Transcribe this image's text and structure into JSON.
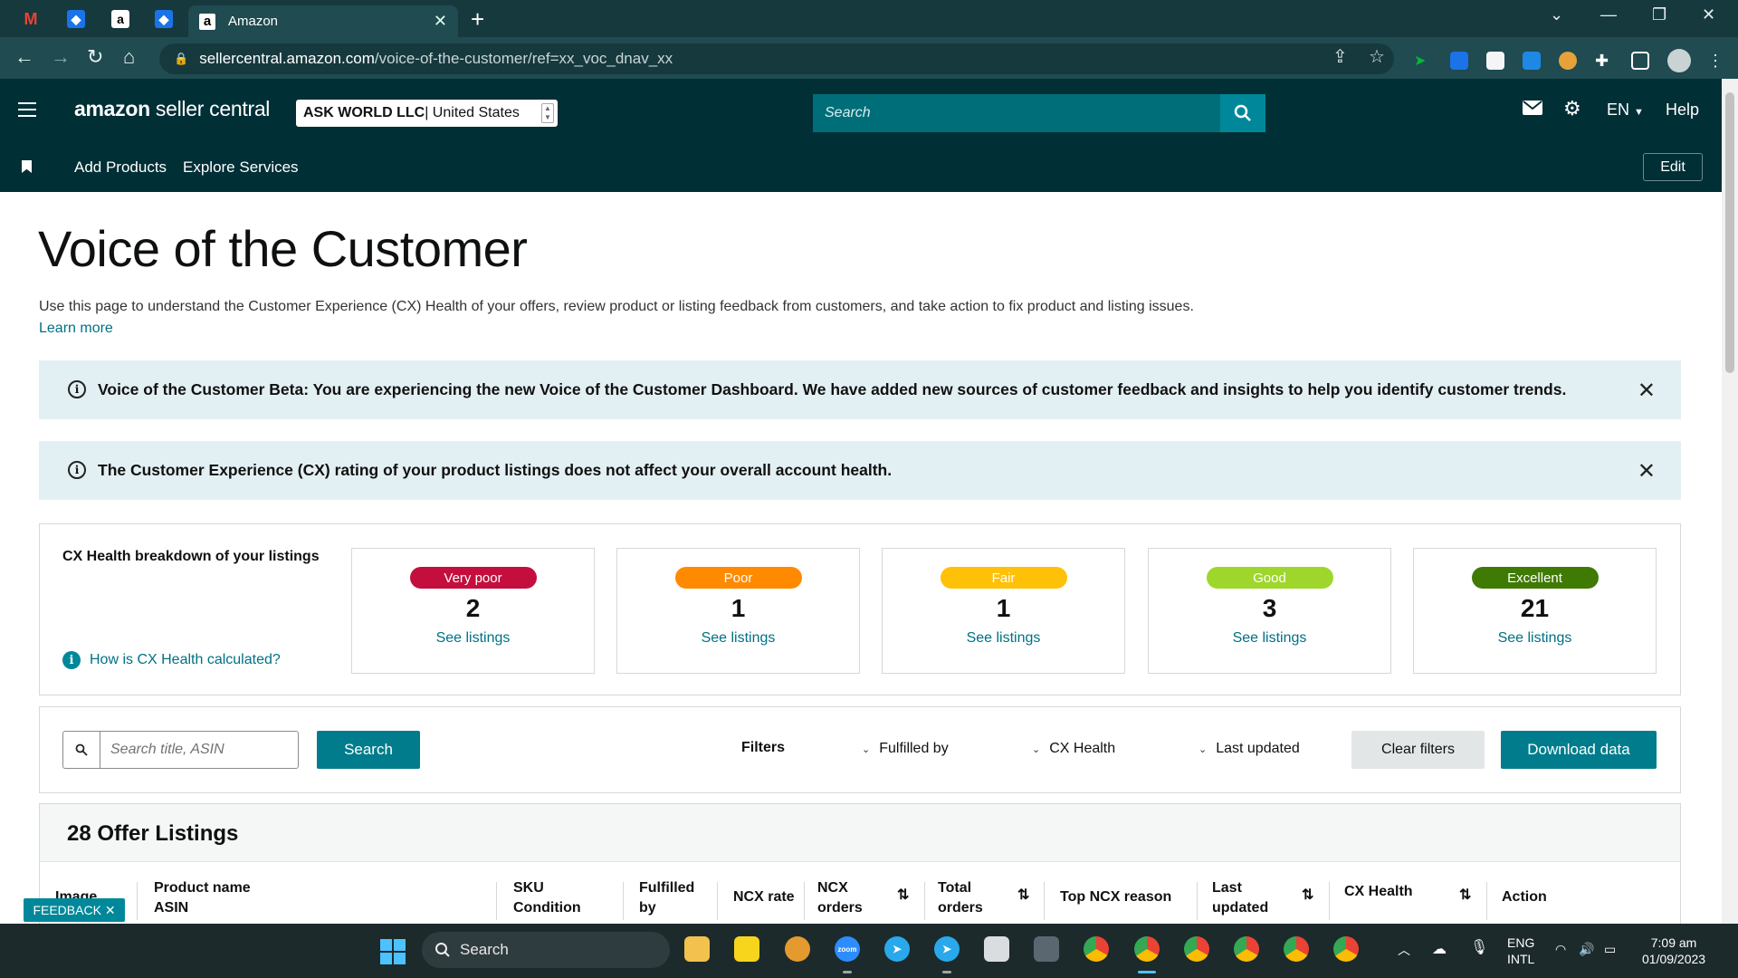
{
  "browser": {
    "tab_title": "Amazon",
    "url_host": "sellercentral.amazon.com",
    "url_path": "/voice-of-the-customer/ref=xx_voc_dnav_xx"
  },
  "header": {
    "logo_brand": "amazon",
    "logo_suffix": " seller central",
    "account_name": "ASK WORLD LLC",
    "account_region": " | United States",
    "search_placeholder": "Search",
    "language": "EN",
    "help": "Help"
  },
  "subnav": {
    "items": [
      "Add Products",
      "Explore Services"
    ],
    "edit": "Edit"
  },
  "page": {
    "title": "Voice of the Customer",
    "description": "Use this page to understand the Customer Experience (CX) Health of your offers, review product or listing feedback from customers, and take action to fix product and listing issues.",
    "learn_more": "Learn more"
  },
  "alerts": [
    "Voice of the Customer Beta: You are experiencing the new Voice of the Customer Dashboard. We have added new sources of customer feedback and insights to help you identify customer trends.",
    "The Customer Experience (CX) rating of your product listings does not affect your overall account health."
  ],
  "cx_health": {
    "title": "CX Health breakdown of your listings",
    "help_link": "How is CX Health calculated?",
    "see_listings": "See listings",
    "categories": [
      {
        "label": "Very poor",
        "count": "2",
        "color": "#c40f3e"
      },
      {
        "label": "Poor",
        "count": "1",
        "color": "#ff8a00"
      },
      {
        "label": "Fair",
        "count": "1",
        "color": "#ffc107"
      },
      {
        "label": "Good",
        "count": "3",
        "color": "#9fd62c"
      },
      {
        "label": "Excellent",
        "count": "21",
        "color": "#3f7a05"
      }
    ]
  },
  "filters": {
    "search_placeholder": "Search title, ASIN",
    "search_button": "Search",
    "label": "Filters",
    "dropdowns": [
      "Fulfilled by",
      "CX Health",
      "Last updated"
    ],
    "clear": "Clear filters",
    "download": "Download data"
  },
  "listings": {
    "title": "28 Offer Listings",
    "columns": [
      [
        "Image",
        ""
      ],
      [
        "Product name",
        "ASIN"
      ],
      [
        "SKU",
        "Condition"
      ],
      [
        "Fulfilled",
        "by"
      ],
      [
        "NCX rate",
        ""
      ],
      [
        "NCX",
        "orders"
      ],
      [
        "Total",
        "orders"
      ],
      [
        "Top NCX reason",
        ""
      ],
      [
        "Last",
        "updated"
      ],
      [
        "CX Health",
        ""
      ],
      [
        "Action",
        ""
      ]
    ]
  },
  "feedback": "FEEDBACK",
  "taskbar": {
    "search": "Search",
    "lang_top": "ENG",
    "lang_bottom": "INTL",
    "time": "7:09 am",
    "date": "01/09/2023"
  }
}
